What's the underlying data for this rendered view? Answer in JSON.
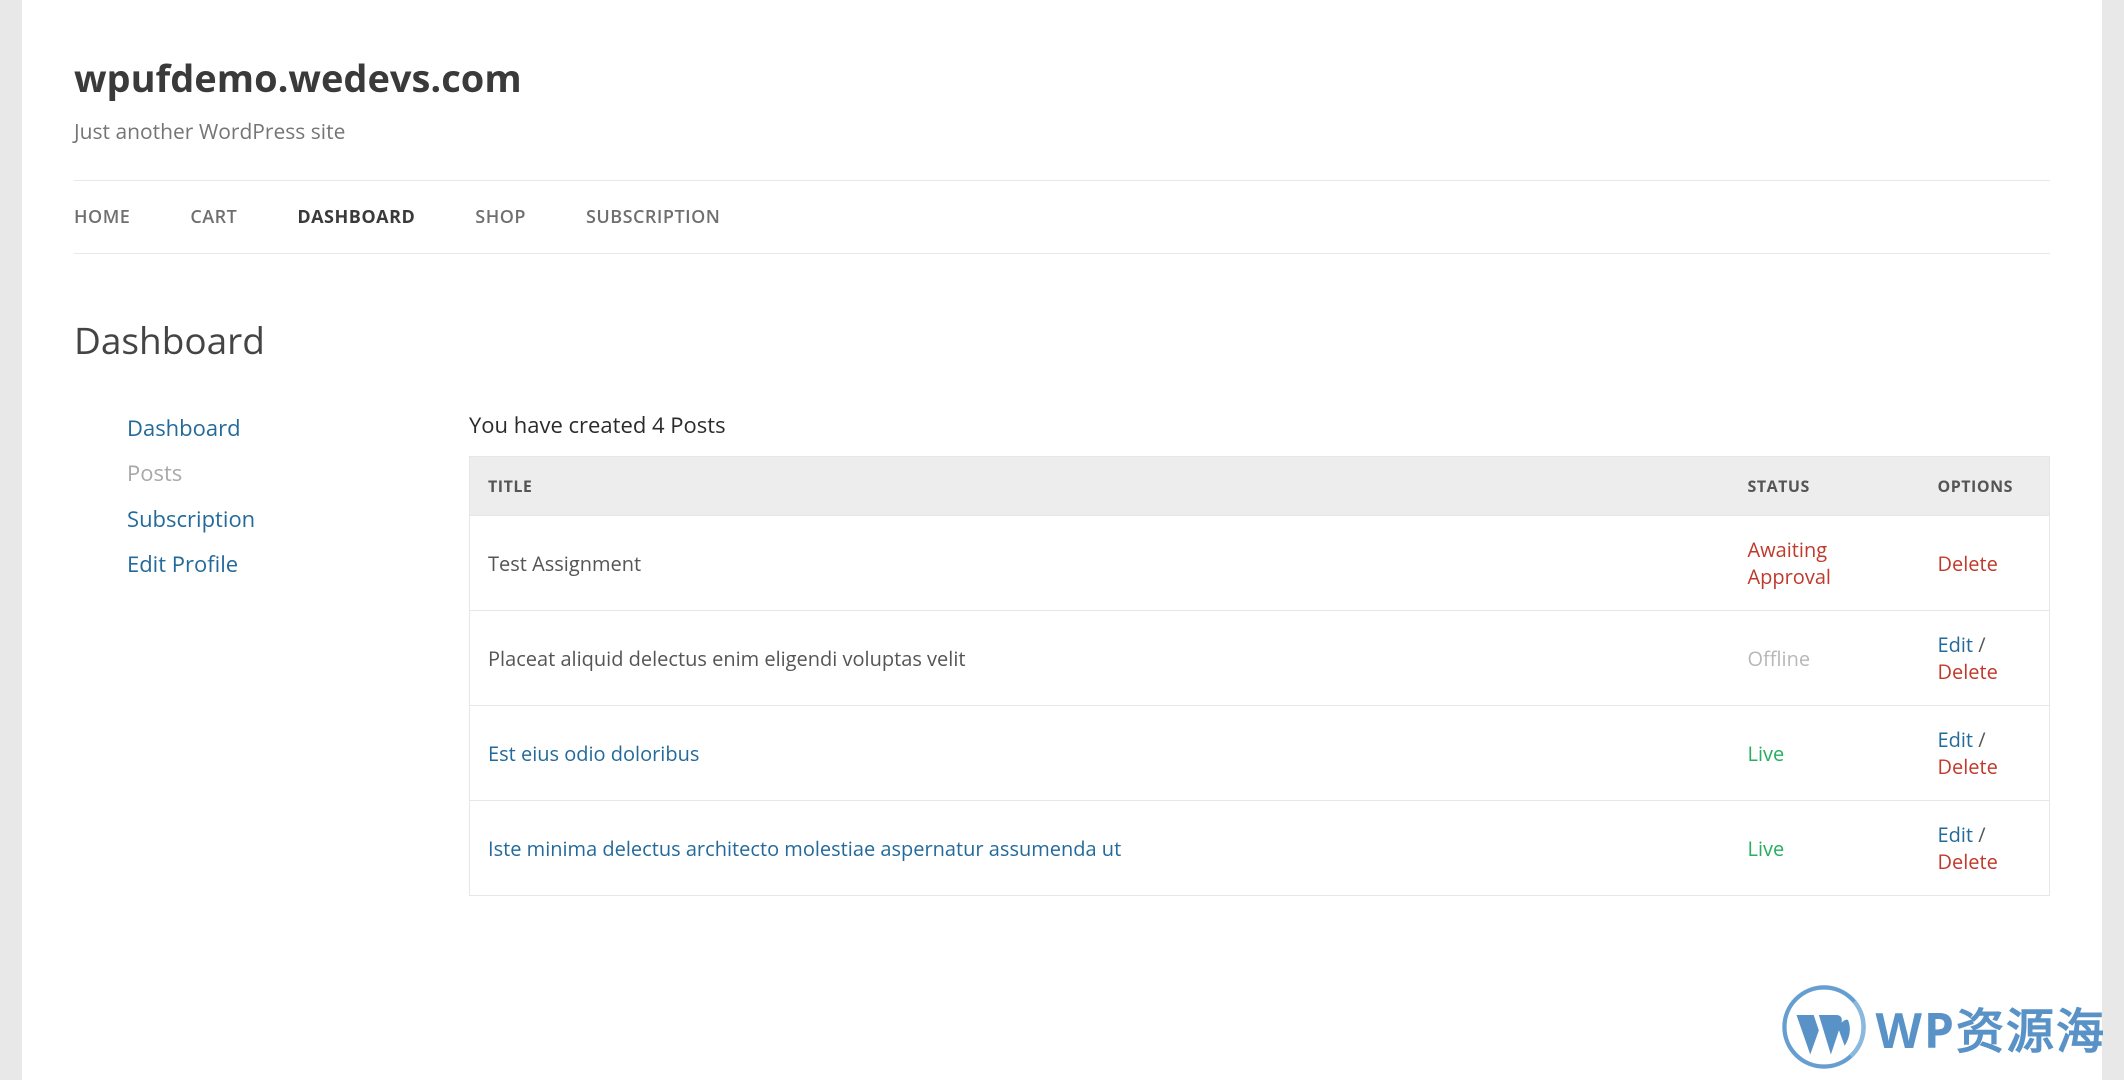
{
  "site": {
    "title": "wpufdemo.wedevs.com",
    "tagline": "Just another WordPress site"
  },
  "nav": {
    "items": [
      {
        "label": "HOME",
        "active": false
      },
      {
        "label": "CART",
        "active": false
      },
      {
        "label": "DASHBOARD",
        "active": true
      },
      {
        "label": "SHOP",
        "active": false
      },
      {
        "label": "SUBSCRIPTION",
        "active": false
      }
    ]
  },
  "page": {
    "heading": "Dashboard"
  },
  "sidebar": {
    "items": [
      {
        "label": "Dashboard",
        "current": false
      },
      {
        "label": "Posts",
        "current": true
      },
      {
        "label": "Subscription",
        "current": false
      },
      {
        "label": "Edit Profile",
        "current": false
      }
    ]
  },
  "posts": {
    "heading": "You have created 4 Posts",
    "columns": {
      "title": "TITLE",
      "status": "STATUS",
      "options": "OPTIONS"
    },
    "rows": [
      {
        "title": "Test Assignment",
        "title_link": false,
        "status_text": "Awaiting Approval",
        "status_class": "awaiting",
        "show_edit": false
      },
      {
        "title": "Placeat aliquid delectus enim eligendi voluptas velit",
        "title_link": false,
        "status_text": "Offline",
        "status_class": "offline",
        "show_edit": true
      },
      {
        "title": "Est eius odio doloribus",
        "title_link": true,
        "status_text": "Live",
        "status_class": "live",
        "show_edit": true
      },
      {
        "title": "Iste minima delectus architecto molestiae aspernatur assumenda ut",
        "title_link": true,
        "status_text": "Live",
        "status_class": "live",
        "show_edit": true
      }
    ],
    "actions": {
      "edit": "Edit",
      "delete": "Delete",
      "sep": " / "
    }
  },
  "watermark": {
    "text": "WP资源海"
  }
}
